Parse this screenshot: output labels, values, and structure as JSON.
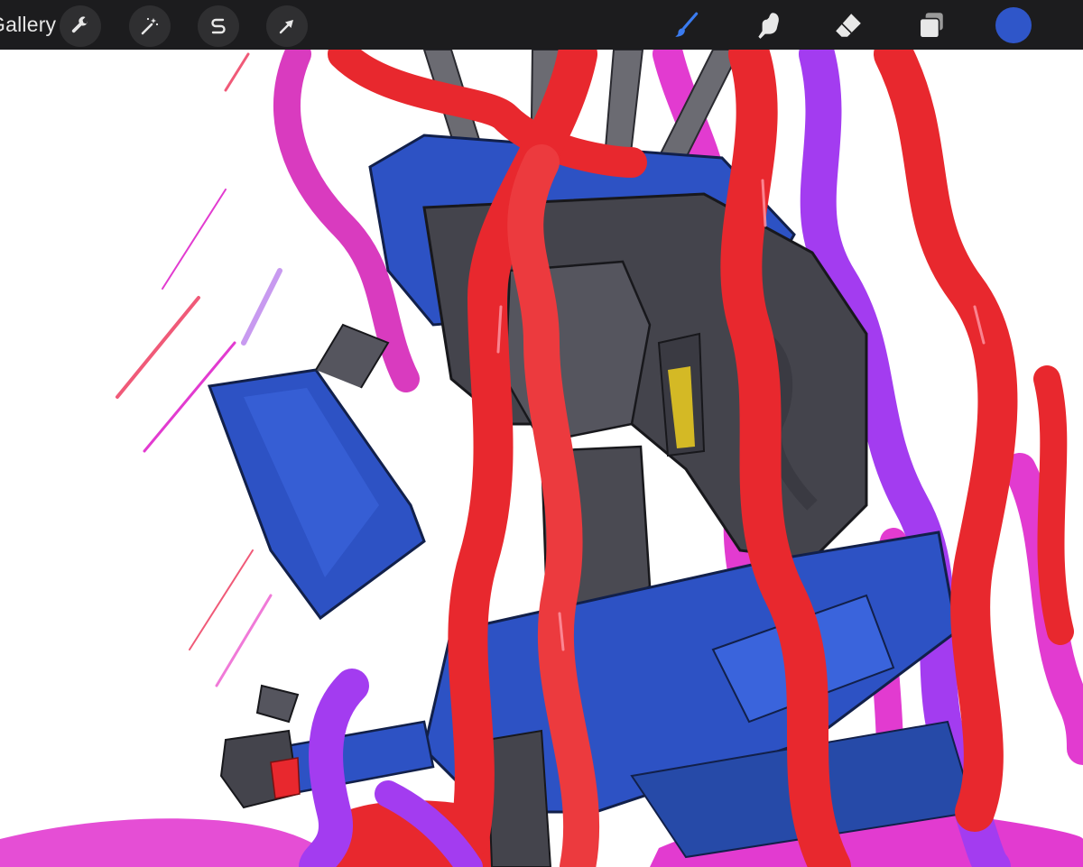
{
  "toolbar": {
    "gallery_label": "Gallery",
    "actions": [
      {
        "name": "actions",
        "icon": "wrench-icon"
      },
      {
        "name": "adjustments",
        "icon": "magic-wand-icon"
      },
      {
        "name": "selection",
        "icon": "selection-s-icon"
      },
      {
        "name": "transform",
        "icon": "arrow-cursor-icon"
      }
    ],
    "tools": [
      {
        "name": "brush",
        "icon": "brush-icon",
        "active": true
      },
      {
        "name": "smudge",
        "icon": "smudge-finger-icon"
      },
      {
        "name": "eraser",
        "icon": "eraser-icon"
      },
      {
        "name": "layers",
        "icon": "layers-icon"
      }
    ],
    "current_color": "#2f56c9",
    "active_tool_color": "#3a7bf0"
  },
  "canvas": {
    "content": "artwork",
    "palette": {
      "robot_blue": "#2d52c4",
      "robot_dark": "#44444c",
      "tendril_red": "#e8282e",
      "tendril_magenta": "#e23bd0",
      "tendril_purple": "#a33cf0",
      "background": "#ffffff"
    }
  }
}
